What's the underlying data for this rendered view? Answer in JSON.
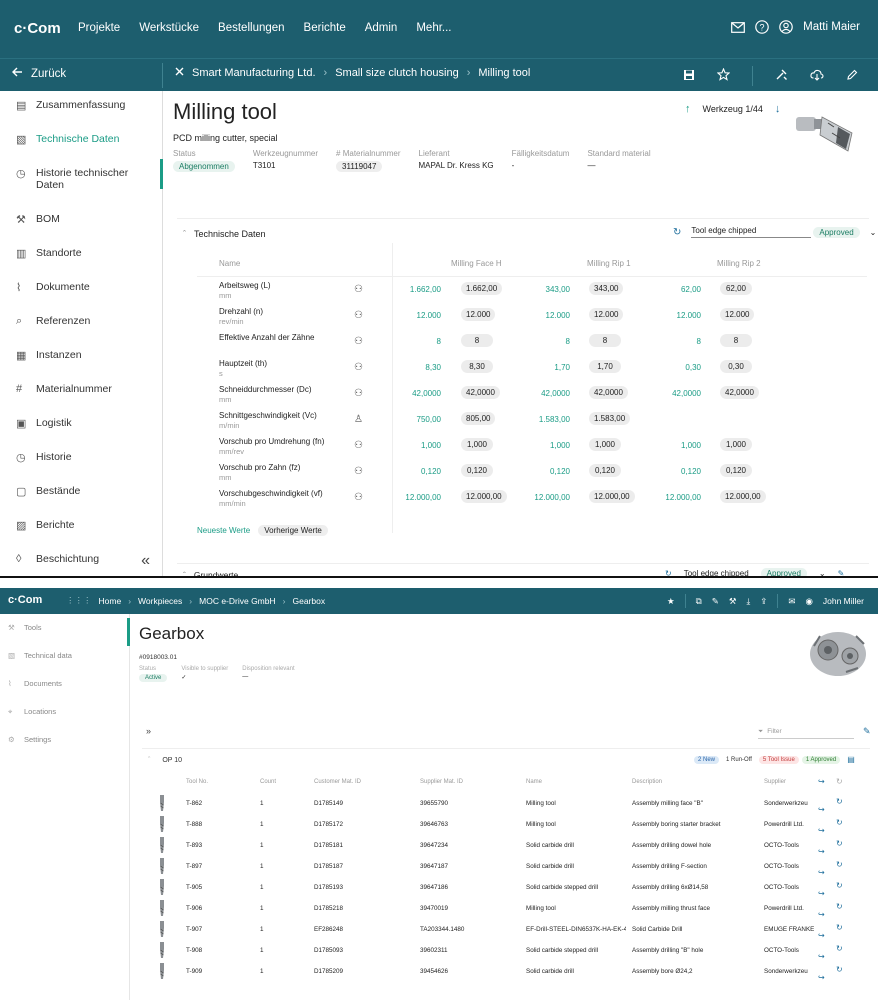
{
  "app1": {
    "logo": "c·Com",
    "nav": [
      "Projekte",
      "Werkstücke",
      "Bestellungen",
      "Berichte",
      "Admin",
      "Mehr..."
    ],
    "user": "Matti Maier",
    "back_label": "Zurück",
    "breadcrumbs": [
      "Smart Manufacturing Ltd.",
      "Small size clutch housing",
      "Milling tool"
    ],
    "sidebar": [
      {
        "label": "Zusammenfassung",
        "icon": "list-icon"
      },
      {
        "label": "Technische Daten",
        "icon": "document-icon"
      },
      {
        "label": "Historie technischer Daten",
        "icon": "history-icon"
      },
      {
        "label": "BOM",
        "icon": "wrench-icon"
      },
      {
        "label": "Standorte",
        "icon": "building-icon"
      },
      {
        "label": "Dokumente",
        "icon": "paperclip-icon"
      },
      {
        "label": "Referenzen",
        "icon": "search-icon"
      },
      {
        "label": "Instanzen",
        "icon": "chart-icon"
      },
      {
        "label": "Materialnummer",
        "icon": "hash-icon"
      },
      {
        "label": "Logistik",
        "icon": "truck-icon"
      },
      {
        "label": "Historie",
        "icon": "history-icon"
      },
      {
        "label": "Bestände",
        "icon": "clipboard-icon"
      },
      {
        "label": "Berichte",
        "icon": "report-icon"
      },
      {
        "label": "Beschichtung",
        "icon": "drop-icon"
      }
    ],
    "title": "Milling tool",
    "subtitle": "PCD milling cutter, special",
    "pager": "Werkzeug 1/44",
    "meta": [
      {
        "label": "Status",
        "value": "Abgenommen"
      },
      {
        "label": "Werkzeugnummer",
        "value": "T3101"
      },
      {
        "label": "# Materialnummer",
        "value": "31119047"
      },
      {
        "label": "Lieferant",
        "value": "MAPAL Dr. Kress KG"
      },
      {
        "label": "Fälligkeitsdatum",
        "value": "-"
      },
      {
        "label": "Standard material",
        "value": "—"
      }
    ],
    "section_title": "Technische Daten",
    "status_dropdown": "Tool edge chipped",
    "approved": "Approved",
    "col_name": "Name",
    "columns": [
      "Milling Face H",
      "Milling Rip 1",
      "Milling Rip 2"
    ],
    "rows": [
      {
        "name": "Arbeitsweg (L)",
        "unit": "mm",
        "icon": "group-icon",
        "vals": [
          [
            "1.662,00",
            "1.662,00"
          ],
          [
            "343,00",
            "343,00"
          ],
          [
            "62,00",
            "62,00"
          ]
        ]
      },
      {
        "name": "Drehzahl (n)",
        "unit": "rev/min",
        "icon": "group-icon",
        "vals": [
          [
            "12.000",
            "12.000"
          ],
          [
            "12.000",
            "12.000"
          ],
          [
            "12.000",
            "12.000"
          ]
        ]
      },
      {
        "name": "Effektive Anzahl der Zähne",
        "unit": "",
        "icon": "group-icon",
        "vals": [
          [
            "8",
            "8"
          ],
          [
            "8",
            "8"
          ],
          [
            "8",
            "8"
          ]
        ]
      },
      {
        "name": "Hauptzeit (th)",
        "unit": "s",
        "icon": "group-icon",
        "vals": [
          [
            "8,30",
            "8,30"
          ],
          [
            "1,70",
            "1,70"
          ],
          [
            "0,30",
            "0,30"
          ]
        ]
      },
      {
        "name": "Schneiddurchmesser (Dc)",
        "unit": "mm",
        "icon": "group-icon",
        "vals": [
          [
            "42,0000",
            "42,0000"
          ],
          [
            "42,0000",
            "42,0000"
          ],
          [
            "42,0000",
            "42,0000"
          ]
        ]
      },
      {
        "name": "Schnittgeschwindigkeit (Vc)",
        "unit": "m/min",
        "icon": "person-icon",
        "vals": [
          [
            "750,00",
            "805,00"
          ],
          [
            "1.583,00",
            "1.583,00"
          ],
          [
            "",
            ""
          ]
        ]
      },
      {
        "name": "Vorschub pro Umdrehung (fn)",
        "unit": "mm/rev",
        "icon": "group-icon",
        "vals": [
          [
            "1,000",
            "1,000"
          ],
          [
            "1,000",
            "1,000"
          ],
          [
            "1,000",
            "1,000"
          ]
        ]
      },
      {
        "name": "Vorschub pro Zahn (fz)",
        "unit": "mm",
        "icon": "group-icon",
        "vals": [
          [
            "0,120",
            "0,120"
          ],
          [
            "0,120",
            "0,120"
          ],
          [
            "0,120",
            "0,120"
          ]
        ]
      },
      {
        "name": "Vorschubgeschwindigkeit (vf)",
        "unit": "mm/min",
        "icon": "group-icon",
        "vals": [
          [
            "12.000,00",
            "12.000,00"
          ],
          [
            "12.000,00",
            "12.000,00"
          ],
          [
            "12.000,00",
            "12.000,00"
          ]
        ]
      }
    ],
    "tab_latest": "Neueste Werte",
    "tab_previous": "Vorherige Werte",
    "grund_title": "Grundwerte",
    "grund_status": "Tool edge chipped",
    "grund_approved": "Approved"
  },
  "app2": {
    "logo": "c·Com",
    "breadcrumbs": [
      "Home",
      "Workpieces",
      "MOC e-Drive GmbH",
      "Gearbox"
    ],
    "user": "John Miller",
    "sidebar": [
      {
        "label": "Tools",
        "icon": "wrench-icon"
      },
      {
        "label": "Technical data",
        "icon": "document-icon"
      },
      {
        "label": "Documents",
        "icon": "paperclip-icon"
      },
      {
        "label": "Locations",
        "icon": "location-icon"
      },
      {
        "label": "Settings",
        "icon": "sliders-icon"
      }
    ],
    "title": "Gearbox",
    "code": "#0918003.01",
    "meta": [
      {
        "label": "Status",
        "value": "Active"
      },
      {
        "label": "Visible to supplier",
        "value": "✓"
      },
      {
        "label": "Disposition relevant",
        "value": "—"
      }
    ],
    "filter_placeholder": "Filter",
    "op_title": "OP 10",
    "badges": [
      "2 New",
      "1 Run-Off",
      "5 Tool Issue",
      "1 Approved"
    ],
    "headers": [
      "Tool No.",
      "Count",
      "Customer Mat. ID",
      "Supplier Mat. ID",
      "Name",
      "Description",
      "Supplier"
    ],
    "rows": [
      [
        "T-862",
        "1",
        "D1785149",
        "39655790",
        "Milling tool",
        "Assembly milling face \"B\"",
        "Sonderwerkzeu"
      ],
      [
        "T-888",
        "1",
        "D1785172",
        "39646763",
        "Milling tool",
        "Assembly boring starter bracket",
        "Powerdrill Ltd."
      ],
      [
        "T-893",
        "1",
        "D1785181",
        "39647234",
        "Solid carbide drill",
        "Assembly drilling dowel hole",
        "OCTO-Tools"
      ],
      [
        "T-897",
        "1",
        "D1785187",
        "39647187",
        "Solid carbide drill",
        "Assembly drilling F-section",
        "OCTO-Tools"
      ],
      [
        "T-905",
        "1",
        "D1785193",
        "39647186",
        "Solid carbide stepped drill",
        "Assembly drilling 6xØ14,58",
        "OCTO-Tools"
      ],
      [
        "T-906",
        "1",
        "D1785218",
        "39470019",
        "Milling tool",
        "Assembly milling thrust face",
        "Powerdrill Ltd."
      ],
      [
        "T-907",
        "1",
        "EF286248",
        "TA203344.1480",
        "EF-Drill-STEEL-DIN6537K-HA-EK-4FF",
        "Solid Carbide Drill",
        "EMUGE FRANKE"
      ],
      [
        "T-908",
        "1",
        "D1785093",
        "39602311",
        "Solid carbide stepped drill",
        "Assembly drilling \"B\" hole",
        "OCTO-Tools"
      ],
      [
        "T-909",
        "1",
        "D1785209",
        "39454626",
        "Solid carbide drill",
        "Assembly bore Ø24,2",
        "Sonderwerkzeu"
      ]
    ]
  }
}
